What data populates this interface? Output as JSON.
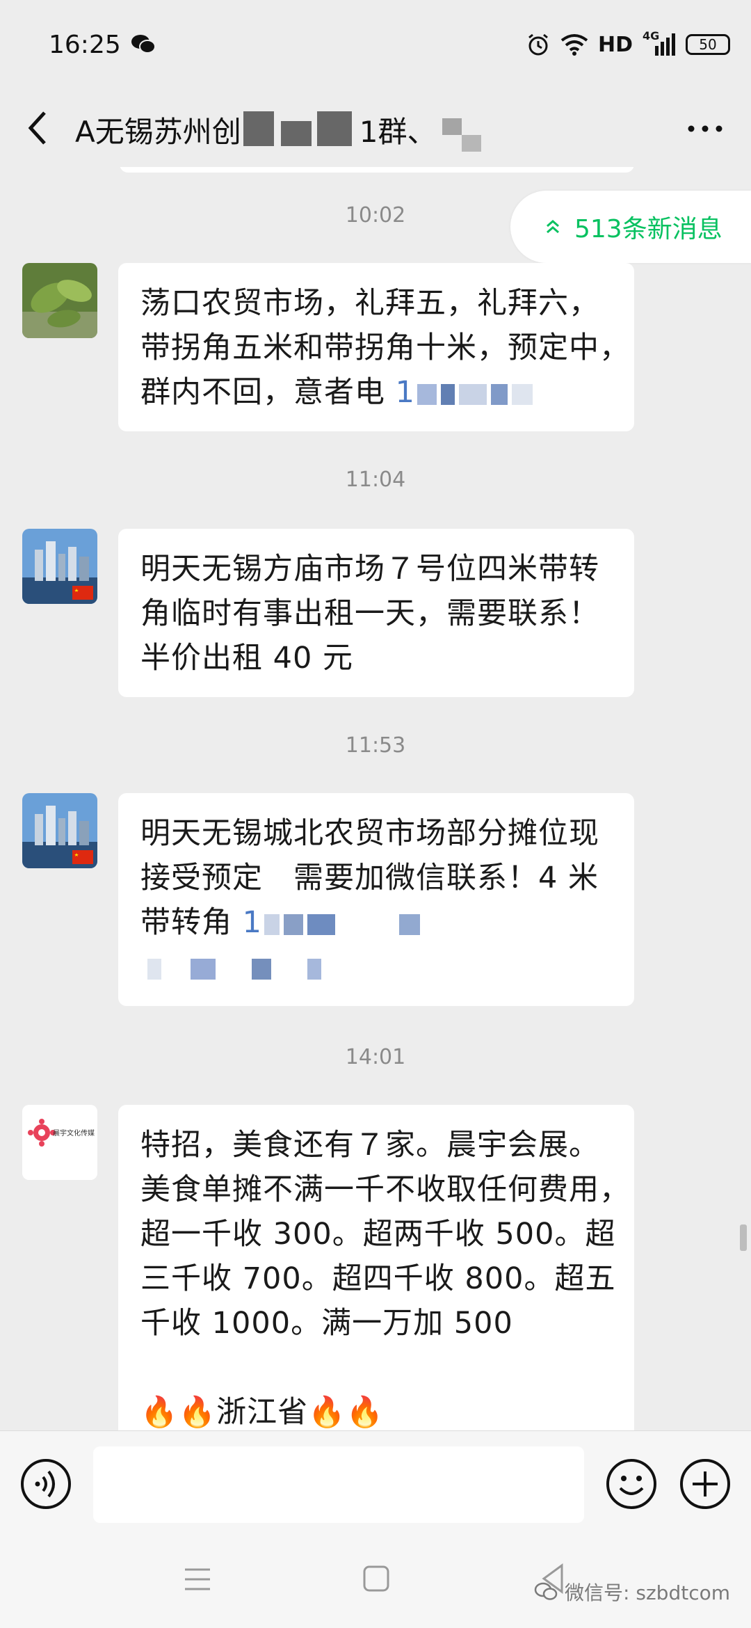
{
  "status_bar": {
    "time": "16:25",
    "network": "HD",
    "signal": "4G",
    "battery": "50"
  },
  "header": {
    "title": "A无锡苏州创",
    "title_suffix": "1群、",
    "back_icon": "chevron-left-icon",
    "more_icon": "more-dots-icon"
  },
  "new_messages": {
    "label": "513条新消息",
    "icon": "double-chevron-up-icon",
    "color": "#07c160"
  },
  "messages": [
    {
      "time": "10:02",
      "avatar": "leaf-photo",
      "lines": [
        "荡口农贸市场，礼拜五，礼拜六，",
        "带拐角五米和带拐角十米，预定中，",
        "群内不回，意者电"
      ],
      "phone_fragment": "1"
    },
    {
      "time": "11:04",
      "avatar": "city-skyline-photo",
      "lines": [
        "明天无锡方庙市场７号位四米带转",
        "角临时有事出租一天，需要联系！",
        "半价出租 40 元"
      ]
    },
    {
      "time": "11:53",
      "avatar": "city-skyline-photo",
      "lines": [
        "明天无锡城北农贸市场部分摊位现",
        "接受预定　需要加微信联系！4 米",
        "带转角"
      ],
      "phone_fragment": "1"
    },
    {
      "time": "14:01",
      "avatar": "chenyu-culture-logo",
      "avatar_text": "晨宇文化传媒",
      "lines": [
        "特招，美食还有７家。晨宇会展。",
        "美食单摊不满一千不收取任何费用，",
        "超一千收 300。超两千收 500。超",
        "三千收 700。超四千收 800。超五",
        "千收 1000。满一万加 500",
        "",
        "🔥🔥浙江省🔥🔥"
      ]
    }
  ],
  "input_bar": {
    "placeholder": "",
    "voice_icon": "voice-icon",
    "emoji_icon": "emoji-icon",
    "plus_icon": "plus-icon"
  },
  "nav_bar": {
    "watermark": "微信号: szbdtcom"
  },
  "colors": {
    "background": "#ededed",
    "bubble": "#ffffff",
    "accent": "#07c160"
  }
}
